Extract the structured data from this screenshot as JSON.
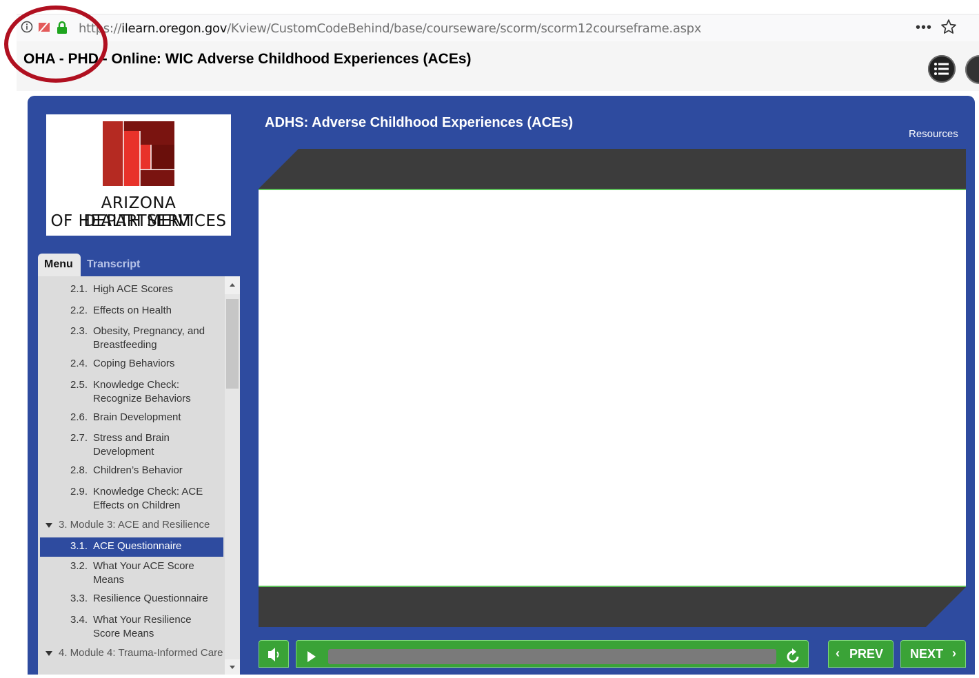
{
  "browser": {
    "url_prefix": "https:",
    "url_slash": "//",
    "url_host": "ilearn.oregon.gov",
    "url_path": "/Kview/CustomCodeBehind/base/courseware/scorm/scorm12courseframe.aspx",
    "page_actions": "•••"
  },
  "lms": {
    "title": "OHA - PHD - Online: WIC Adverse Childhood Experiences (ACEs)"
  },
  "logo": {
    "line1": "ARIZONA DEPARTMENT",
    "line2": "OF HEALTH SERVICES"
  },
  "course": {
    "title": "ADHS: Adverse Childhood Experiences (ACEs)",
    "resources_label": "Resources"
  },
  "tabs": {
    "menu": "Menu",
    "transcript": "Transcript",
    "active": "Menu"
  },
  "menu": {
    "items": [
      {
        "num": "2.1.",
        "label": "High ACE Scores"
      },
      {
        "num": "2.2.",
        "label": "Effects on Health"
      },
      {
        "num": "2.3.",
        "label": "Obesity, Pregnancy, and Breastfeeding"
      },
      {
        "num": "2.4.",
        "label": "Coping Behaviors"
      },
      {
        "num": "2.5.",
        "label": "Knowledge Check: Recognize Behaviors"
      },
      {
        "num": "2.6.",
        "label": "Brain Development"
      },
      {
        "num": "2.7.",
        "label": "Stress and Brain Development"
      },
      {
        "num": "2.8.",
        "label": "Children’s Behavior"
      },
      {
        "num": "2.9.",
        "label": "Knowledge Check: ACE Effects on Children"
      },
      {
        "num": "3.",
        "label": "Module 3: ACE and Resilience"
      },
      {
        "num": "3.1.",
        "label": "ACE Questionnaire",
        "active": true
      },
      {
        "num": "3.2.",
        "label": "What Your ACE Score Means"
      },
      {
        "num": "3.3.",
        "label": "Resilience Questionnaire"
      },
      {
        "num": "3.4.",
        "label": "What Your Resilience Score Means"
      },
      {
        "num": "4.",
        "label": "Module 4: Trauma-Informed Care"
      }
    ]
  },
  "controls": {
    "prev_label": "PREV",
    "next_label": "NEXT"
  },
  "colors": {
    "player_blue": "#2e4b9f",
    "control_green": "#3aa337",
    "highlight_red": "#b01020",
    "logo_red": "#e8322a"
  }
}
